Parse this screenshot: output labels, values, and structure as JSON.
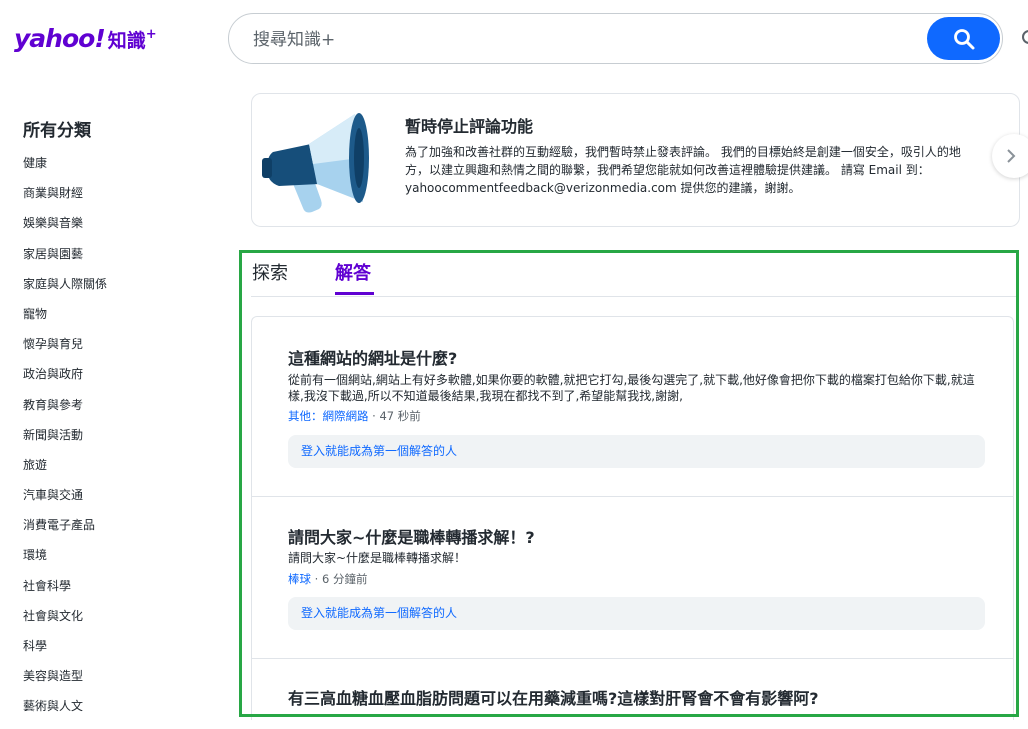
{
  "header": {
    "logo_yahoo": "yahoo!",
    "logo_product": "知識",
    "logo_plus": "+",
    "search_placeholder": "搜尋知識+"
  },
  "sidebar": {
    "title": "所有分類",
    "categories": [
      "健康",
      "商業與財經",
      "娛樂與音樂",
      "家居與園藝",
      "家庭與人際關係",
      "寵物",
      "懷孕與育兒",
      "政治與政府",
      "教育與參考",
      "新聞與活動",
      "旅遊",
      "汽車與交通",
      "消費電子產品",
      "環境",
      "社會科學",
      "社會與文化",
      "科學",
      "美容與造型",
      "藝術與人文"
    ]
  },
  "notice": {
    "title": "暫時停止評論功能",
    "body": "為了加強和改善社群的互動經驗，我們暫時禁止發表評論。 我們的目標始終是創建一個安全，吸引人的地方，以建立興趣和熱情之間的聯繫，我們希望您能就如何改善這裡體驗提供建議。 請寫 Email 到：yahoocommentfeedback@verizonmedia.com 提供您的建議，謝謝。"
  },
  "tabs": {
    "explore": "探索",
    "answer": "解答"
  },
  "questions": [
    {
      "title": "這種網站的網址是什麼?",
      "body": "從前有一個網站,網站上有好多軟體,如果你要的軟體,就把它打勾,最後勾選完了,就下載,他好像會把你下載的檔案打包給你下載,就這樣,我沒下載過,所以不知道最後結果,我現在都找不到了,希望能幫我找,謝謝,",
      "category": "其他：網際網路",
      "time": "47 秒前",
      "answer_prompt": "登入就能成為第一個解答的人"
    },
    {
      "title": "請問大家~什麼是職棒轉播求解！?",
      "body": "請問大家~什麼是職棒轉播求解！",
      "category": "棒球",
      "time": "6 分鐘前",
      "answer_prompt": "登入就能成為第一個解答的人"
    },
    {
      "title": "有三高血糖血壓血脂肪問題可以在用藥減重嗎?這樣對肝腎會不會有影響阿?"
    }
  ],
  "colors": {
    "brand": "#6001d2",
    "link": "#0f69ff",
    "highlight": "#28a745"
  }
}
